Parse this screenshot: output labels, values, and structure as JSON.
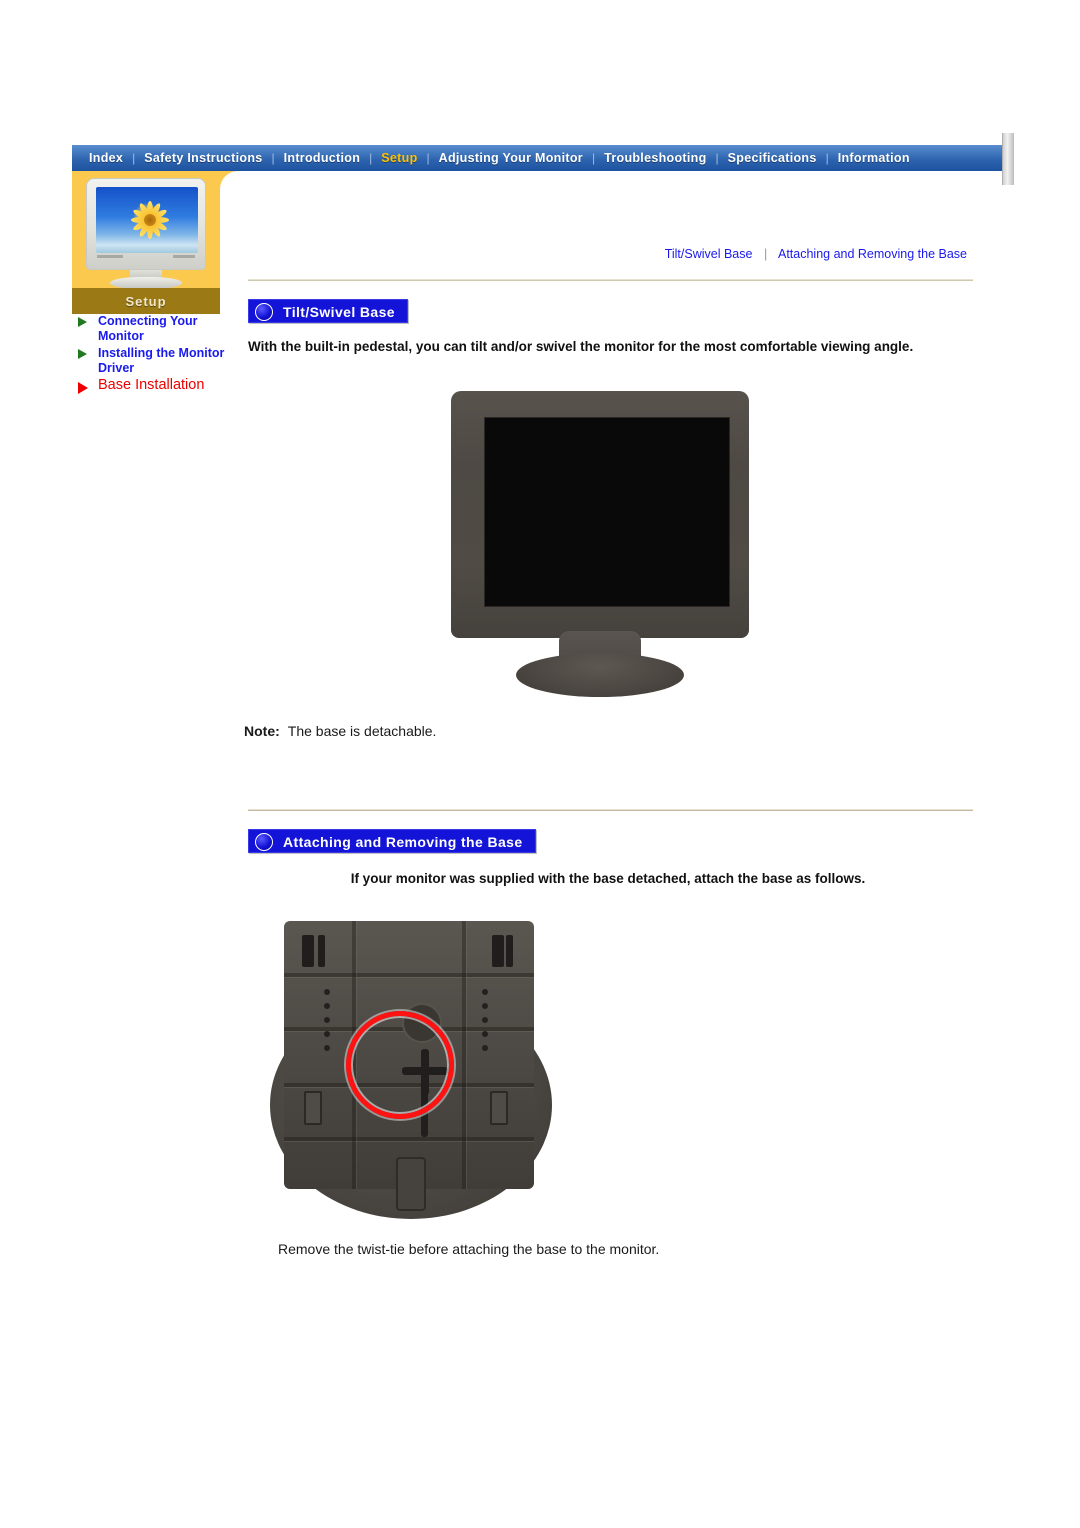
{
  "nav": {
    "items": [
      {
        "label": "Index",
        "active": false
      },
      {
        "label": "Safety Instructions",
        "active": false
      },
      {
        "label": "Introduction",
        "active": false
      },
      {
        "label": "Setup",
        "active": true
      },
      {
        "label": "Adjusting Your Monitor",
        "active": false
      },
      {
        "label": "Troubleshooting",
        "active": false
      },
      {
        "label": "Specifications",
        "active": false
      },
      {
        "label": "Information",
        "active": false
      }
    ],
    "separator": "|"
  },
  "sidebar": {
    "section_label": "Setup",
    "items": [
      {
        "label": "Connecting Your Monitor",
        "active": false
      },
      {
        "label": "Installing the Monitor Driver",
        "active": false
      },
      {
        "label": "Base Installation",
        "active": true
      }
    ]
  },
  "breadcrumb": {
    "first": "Tilt/Swivel Base",
    "separator": "|",
    "second": "Attaching and Removing the Base"
  },
  "sections": {
    "tilt": {
      "heading": "Tilt/Swivel Base",
      "body": "With the built-in pedestal, you can tilt and/or swivel the monitor for the most comfortable viewing angle.",
      "note_label": "Note:",
      "note_text": "The base is detachable."
    },
    "attaching": {
      "heading": "Attaching and Removing the Base",
      "body": "If your monitor was supplied with the base detached, attach the base as follows.",
      "caption": "Remove the twist-tie before attaching the base to the monitor."
    }
  },
  "colors": {
    "nav_blue": "#2d63ae",
    "nav_active": "#ffc000",
    "amber": "#fac94e",
    "setup_tag": "#9b7a16",
    "link_blue": "#1a1aee",
    "active_red": "#ee0000",
    "banner_blue": "#1414d8",
    "rule": "#cfc9ad",
    "highlight_ring": "#ff1212"
  }
}
